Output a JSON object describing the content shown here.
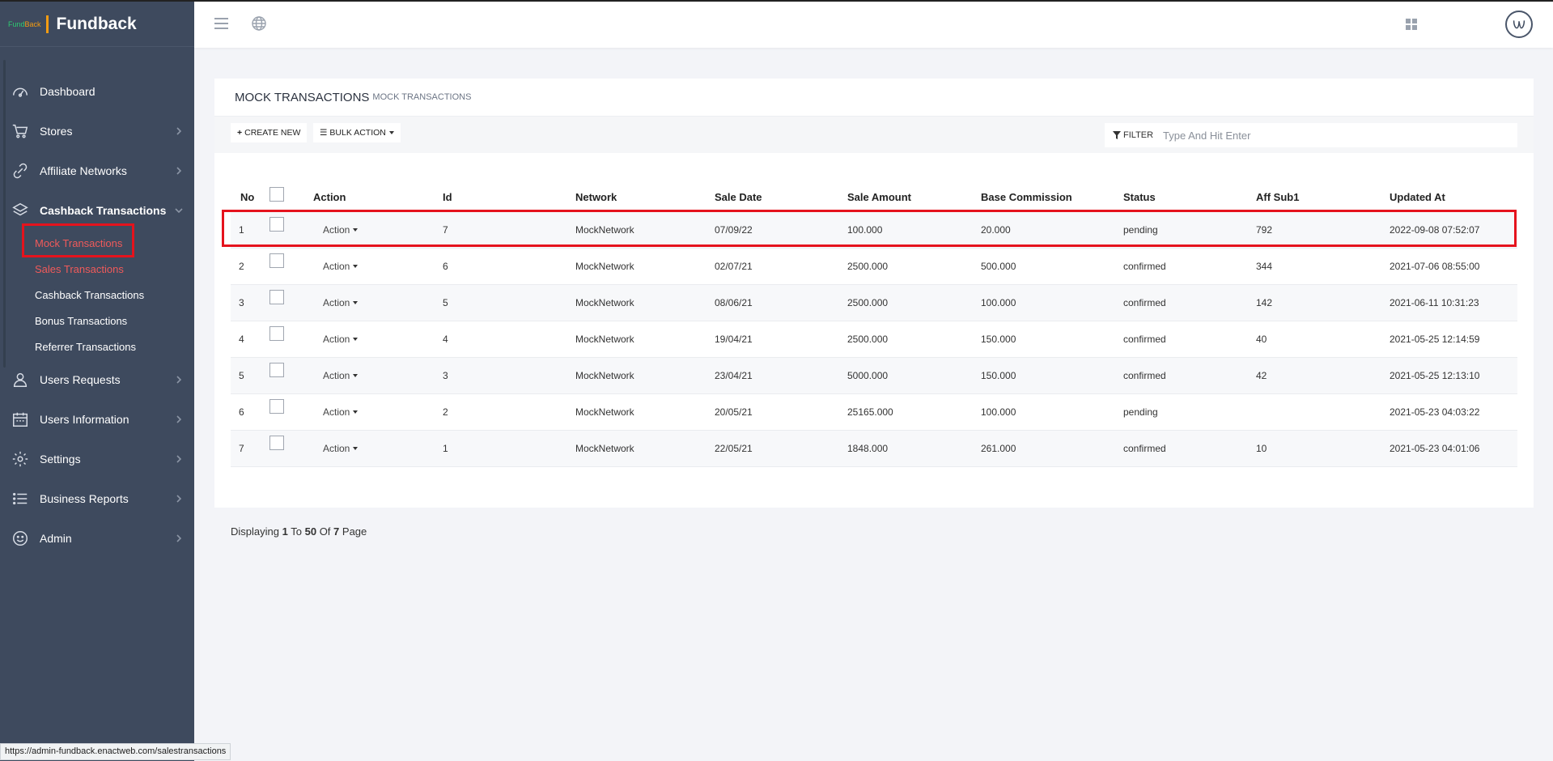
{
  "brand": {
    "logo_part1": "Fund",
    "logo_part2": "Back",
    "name": "Fundback"
  },
  "sidebar": {
    "items": [
      {
        "label": "Dashboard",
        "icon": "speedometer-icon"
      },
      {
        "label": "Stores",
        "icon": "cart-icon"
      },
      {
        "label": "Affiliate Networks",
        "icon": "link-icon"
      },
      {
        "label": "Cashback Transactions",
        "icon": "layers-icon"
      },
      {
        "label": "Users Requests",
        "icon": "user-icon"
      },
      {
        "label": "Users Information",
        "icon": "calendar-icon"
      },
      {
        "label": "Settings",
        "icon": "gear-icon"
      },
      {
        "label": "Business Reports",
        "icon": "list-icon"
      },
      {
        "label": "Admin",
        "icon": "smile-icon"
      }
    ],
    "submenu": [
      {
        "label": "Mock Transactions"
      },
      {
        "label": "Sales Transactions"
      },
      {
        "label": "Cashback Transactions"
      },
      {
        "label": "Bonus Transactions"
      },
      {
        "label": "Referrer Transactions"
      }
    ]
  },
  "page": {
    "title": "MOCK TRANSACTIONS",
    "subtitle": "MOCK TRANSACTIONS",
    "create_label": "CREATE NEW",
    "bulk_label": "BULK ACTION",
    "filter_label": "FILTER",
    "filter_placeholder": "Type And Hit Enter"
  },
  "table": {
    "headers": [
      "No",
      "",
      "Action",
      "Id",
      "Network",
      "Sale Date",
      "Sale Amount",
      "Base Commission",
      "Status",
      "Aff Sub1",
      "Updated At"
    ],
    "action_label": "Action",
    "rows": [
      [
        "1",
        "7",
        "MockNetwork",
        "07/09/22",
        "100.000",
        "20.000",
        "pending",
        "792",
        "2022-09-08 07:52:07"
      ],
      [
        "2",
        "6",
        "MockNetwork",
        "02/07/21",
        "2500.000",
        "500.000",
        "confirmed",
        "344",
        "2021-07-06 08:55:00"
      ],
      [
        "3",
        "5",
        "MockNetwork",
        "08/06/21",
        "2500.000",
        "100.000",
        "confirmed",
        "142",
        "2021-06-11 10:31:23"
      ],
      [
        "4",
        "4",
        "MockNetwork",
        "19/04/21",
        "2500.000",
        "150.000",
        "confirmed",
        "40",
        "2021-05-25 12:14:59"
      ],
      [
        "5",
        "3",
        "MockNetwork",
        "23/04/21",
        "5000.000",
        "150.000",
        "confirmed",
        "42",
        "2021-05-25 12:13:10"
      ],
      [
        "6",
        "2",
        "MockNetwork",
        "20/05/21",
        "25165.000",
        "100.000",
        "pending",
        "",
        "2021-05-23 04:03:22"
      ],
      [
        "7",
        "1",
        "MockNetwork",
        "22/05/21",
        "1848.000",
        "261.000",
        "confirmed",
        "10",
        "2021-05-23 04:01:06"
      ]
    ]
  },
  "pager": {
    "prefix": "Displaying",
    "from": "1",
    "to_word": "To",
    "to": "50",
    "of_word": "Of",
    "total": "7",
    "suffix": "Page"
  },
  "status_url": "https://admin-fundback.enactweb.com/salestransactions",
  "colors": {
    "sidebar": "#3e4a5e",
    "active": "#f05a5a",
    "highlight": "#e5131d"
  }
}
